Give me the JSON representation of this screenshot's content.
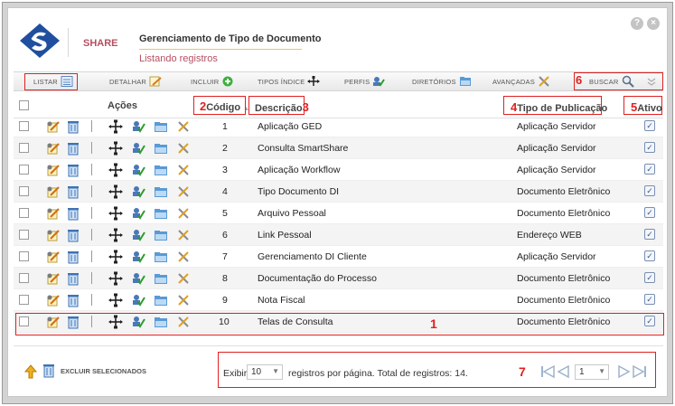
{
  "header": {
    "app_name": "SHARE",
    "title": "Gerenciamento de Tipo de Documento",
    "subtitle": "Listando registros",
    "help_label": "?",
    "close_label": "×"
  },
  "toolbar": {
    "items": [
      {
        "label": "LISTAR"
      },
      {
        "label": "DETALHAR"
      },
      {
        "label": "INCLUIR"
      },
      {
        "label": "TIPOS ÍNDICE"
      },
      {
        "label": "PERFIS"
      },
      {
        "label": "DIRETÓRIOS"
      },
      {
        "label": "AVANÇADAS"
      }
    ],
    "search_label": "BUSCAR"
  },
  "table": {
    "headers": {
      "acoes": "Ações",
      "codigo": "Código",
      "descricao": "Descrição",
      "tipo": "Tipo de Publicação",
      "ativo": "Ativo"
    },
    "rows": [
      {
        "codigo": "1",
        "descricao": "Aplicação GED",
        "tipo": "Aplicação Servidor",
        "ativo": true
      },
      {
        "codigo": "2",
        "descricao": "Consulta SmartShare",
        "tipo": "Aplicação Servidor",
        "ativo": true
      },
      {
        "codigo": "3",
        "descricao": "Aplicação Workflow",
        "tipo": "Aplicação Servidor",
        "ativo": true
      },
      {
        "codigo": "4",
        "descricao": "Tipo Documento DI",
        "tipo": "Documento Eletrônico",
        "ativo": true
      },
      {
        "codigo": "5",
        "descricao": "Arquivo Pessoal",
        "tipo": "Documento Eletrônico",
        "ativo": true
      },
      {
        "codigo": "6",
        "descricao": "Link Pessoal",
        "tipo": "Endereço WEB",
        "ativo": true
      },
      {
        "codigo": "7",
        "descricao": "Gerenciamento DI Cliente",
        "tipo": "Aplicação Servidor",
        "ativo": true
      },
      {
        "codigo": "8",
        "descricao": "Documentação do Processo",
        "tipo": "Documento Eletrônico",
        "ativo": true
      },
      {
        "codigo": "9",
        "descricao": "Nota Fiscal",
        "tipo": "Documento Eletrônico",
        "ativo": true
      },
      {
        "codigo": "10",
        "descricao": "Telas de Consulta",
        "tipo": "Documento Eletrônico",
        "ativo": true
      }
    ]
  },
  "footer": {
    "delete_selected_label": "EXCLUIR SELECIONADOS",
    "show_label": "Exibir",
    "page_size": "10",
    "records_text": "registros por página. Total de registros: 14.",
    "current_page": "1"
  },
  "annotations": {
    "n1": "1",
    "n2": "2",
    "n3": "3",
    "n4": "4",
    "n5": "5",
    "n6": "6",
    "n7": "7"
  },
  "colors": {
    "accent": "#b64f62",
    "annotation": "#e02020",
    "toolbar_bg": "#ececec"
  }
}
